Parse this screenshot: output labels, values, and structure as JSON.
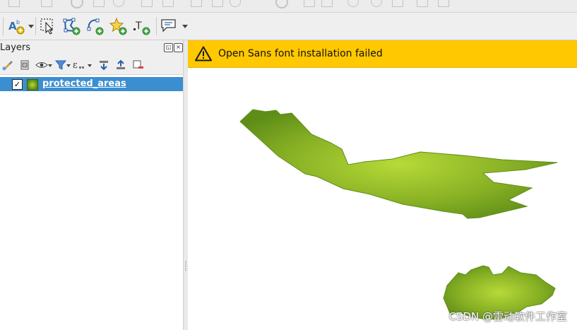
{
  "toolbar": {
    "tools": [
      {
        "name": "label-tool-icon"
      },
      {
        "name": "select-features-icon"
      },
      {
        "name": "add-polygon-icon"
      },
      {
        "name": "add-line-icon"
      },
      {
        "name": "add-point-star-icon"
      },
      {
        "name": "add-text-annotation-icon"
      },
      {
        "name": "map-tips-icon"
      }
    ]
  },
  "layers_panel": {
    "title": "Layers",
    "layers": [
      {
        "name": "protected_areas",
        "checked": true
      }
    ]
  },
  "message_bar": {
    "text": "Open Sans font installation failed",
    "level": "warning",
    "color": "#ffc800"
  },
  "map": {
    "features": [
      {
        "name": "protected-area-large-polygon"
      },
      {
        "name": "protected-area-small-polygon"
      }
    ],
    "fill_colors": {
      "center": "#b7da38",
      "edge": "#5f8e18"
    }
  },
  "watermark": "CSDN @雷动软件工作室"
}
